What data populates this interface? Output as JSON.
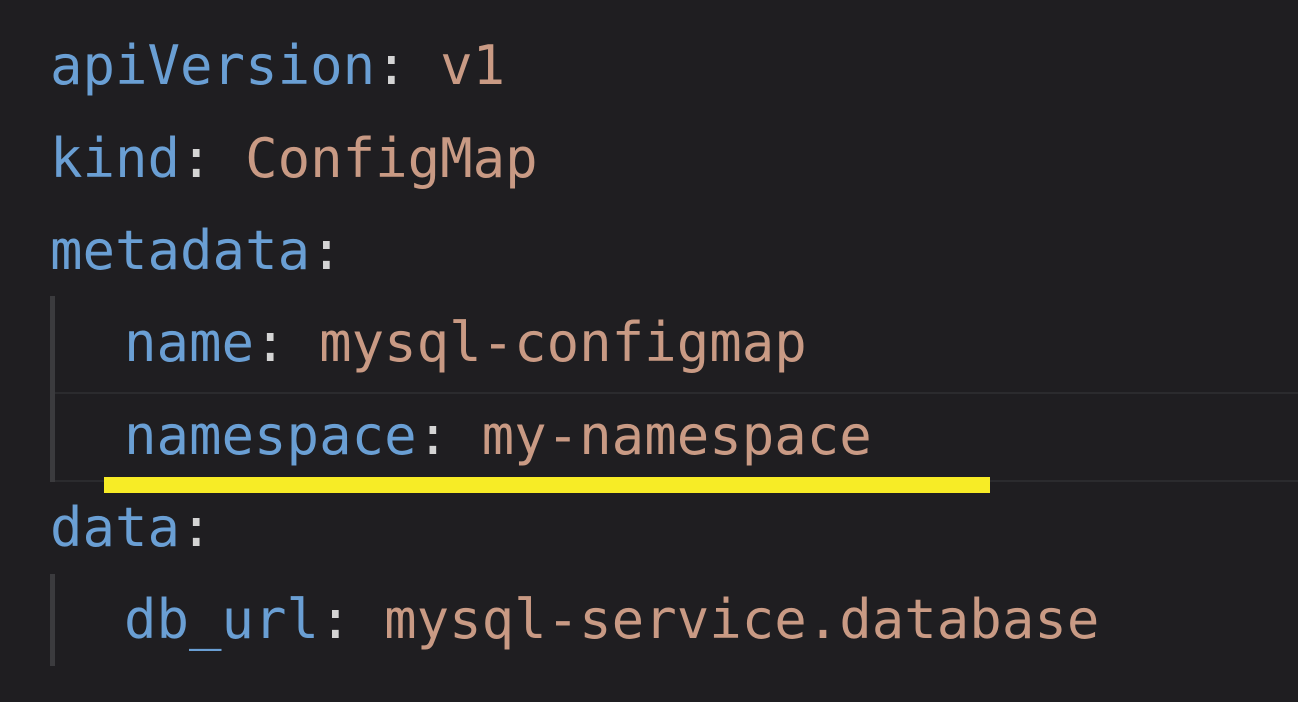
{
  "editor": {
    "lines": [
      {
        "key": "apiVersion",
        "colon": ":",
        "value": "v1"
      },
      {
        "key": "kind",
        "colon": ":",
        "value": "ConfigMap"
      },
      {
        "key": "metadata",
        "colon": ":",
        "value": ""
      },
      {
        "key": "name",
        "colon": ":",
        "value": "mysql-configmap"
      },
      {
        "key": "namespace",
        "colon": ":",
        "value": "my-namespace"
      },
      {
        "key": "data",
        "colon": ":",
        "value": ""
      },
      {
        "key": "db_url",
        "colon": ":",
        "value": "mysql-service.database"
      }
    ]
  },
  "colors": {
    "background": "#1f1e21",
    "key": "#6a9fd4",
    "value": "#c99a84",
    "punctuation": "#d4d4d4",
    "highlight": "#f7ec26"
  }
}
